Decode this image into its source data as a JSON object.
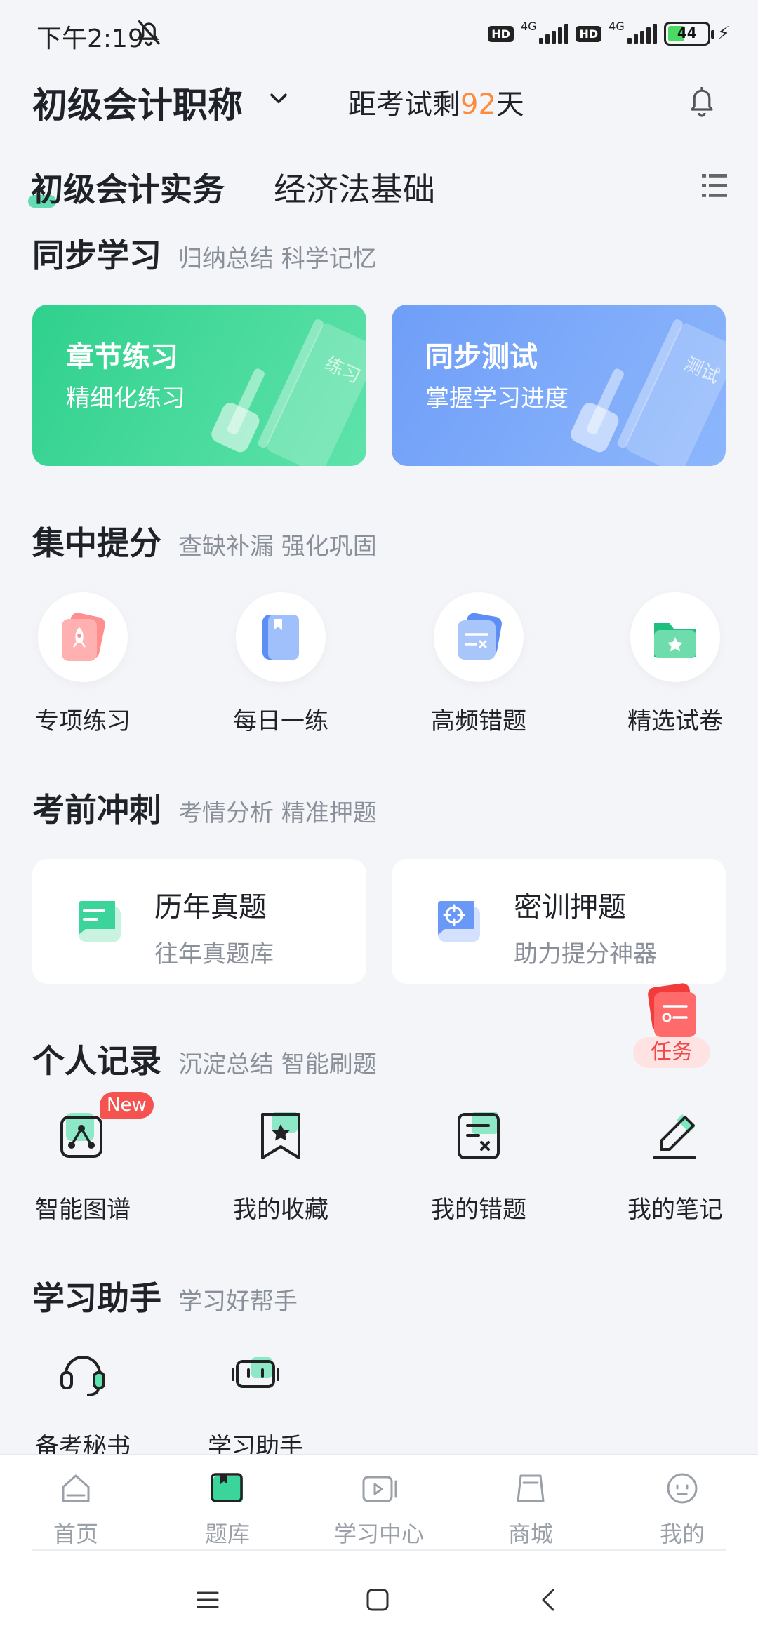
{
  "status_bar": {
    "time": "下午2:19",
    "hd": "HD",
    "net": "4G",
    "battery": "44",
    "battery_level": 0.44
  },
  "header": {
    "exam_name": "初级会计职称",
    "countdown_prefix": "距考试剩",
    "countdown_days": "92",
    "countdown_suffix": "天"
  },
  "subject_tabs": [
    {
      "label": "初级会计实务",
      "active": true
    },
    {
      "label": "经济法基础",
      "active": false
    }
  ],
  "sync_study": {
    "title": "同步学习",
    "subtitle": "归纳总结  科学记忆",
    "cards": [
      {
        "title": "章节练习",
        "subtitle": "精细化练习",
        "deco_text": "练习"
      },
      {
        "title": "同步测试",
        "subtitle": "掌握学习进度",
        "deco_text": "测试"
      }
    ]
  },
  "focus": {
    "title": "集中提分",
    "subtitle": "查缺补漏 强化巩固",
    "items": [
      {
        "label": "专项练习",
        "icon": "rocket-card-icon"
      },
      {
        "label": "每日一练",
        "icon": "book-icon"
      },
      {
        "label": "高频错题",
        "icon": "wrong-question-card-icon"
      },
      {
        "label": "精选试卷",
        "icon": "star-folder-icon"
      }
    ]
  },
  "sprint": {
    "title": "考前冲刺",
    "subtitle": "考情分析 精准押题",
    "cards": [
      {
        "title": "历年真题",
        "subtitle": "往年真题库",
        "icon": "chat-list-icon"
      },
      {
        "title": "密训押题",
        "subtitle": "助力提分神器",
        "icon": "target-chat-icon"
      }
    ]
  },
  "task": {
    "label": "任务"
  },
  "records": {
    "title": "个人记录",
    "subtitle": "沉淀总结 智能刷题",
    "new_badge": "New",
    "items": [
      {
        "label": "智能图谱",
        "icon": "graph-icon"
      },
      {
        "label": "我的收藏",
        "icon": "bookmark-star-icon"
      },
      {
        "label": "我的错题",
        "icon": "wrong-note-icon"
      },
      {
        "label": "我的笔记",
        "icon": "pen-icon"
      }
    ]
  },
  "assistant": {
    "title": "学习助手",
    "subtitle": "学习好帮手",
    "items": [
      {
        "label": "备考秘书",
        "icon": "headset-icon"
      },
      {
        "label": "学习助手",
        "icon": "robot-icon"
      }
    ]
  },
  "bottom_nav": [
    {
      "label": "首页",
      "icon": "home-icon",
      "active": false
    },
    {
      "label": "题库",
      "icon": "question-bank-icon",
      "active": true
    },
    {
      "label": "学习中心",
      "icon": "play-icon",
      "active": false
    },
    {
      "label": "商城",
      "icon": "shop-bag-icon",
      "active": false
    },
    {
      "label": "我的",
      "icon": "profile-icon",
      "active": false
    }
  ],
  "colors": {
    "accent_green": "#2fd08d",
    "accent_blue": "#6f9ef8",
    "countdown_orange": "#ff8a3c",
    "badge_red": "#f5534f"
  }
}
